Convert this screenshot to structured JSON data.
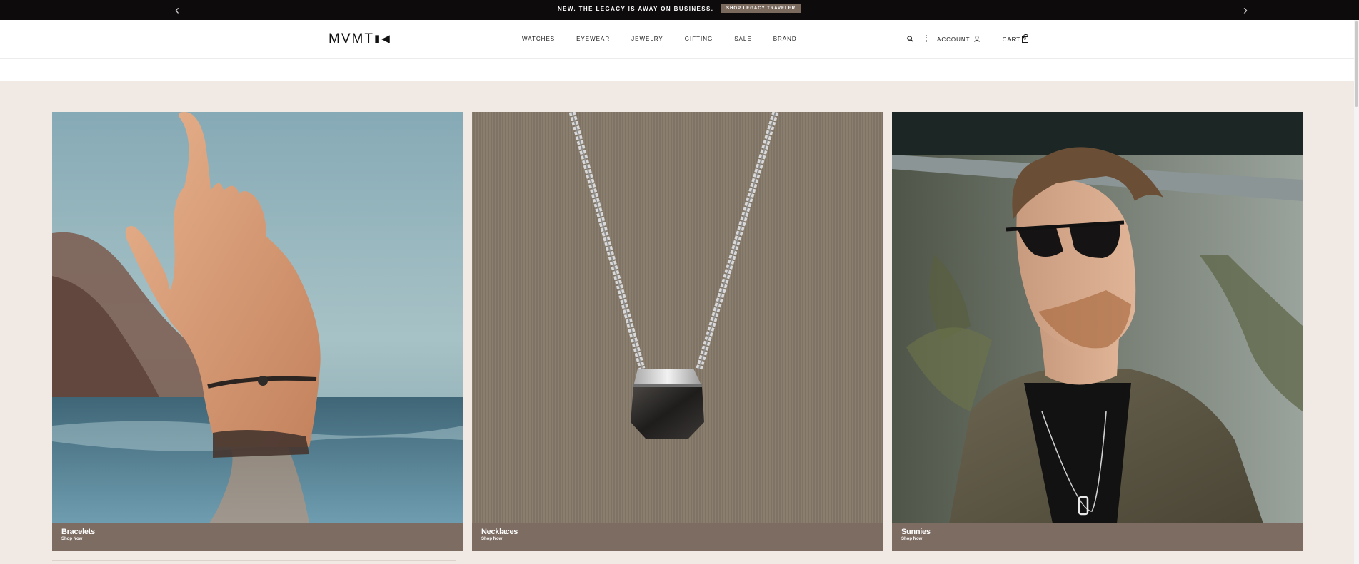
{
  "announcement": {
    "message": "NEW. THE LEGACY IS AWAY ON BUSINESS.",
    "cta": "SHOP LEGACY TRAVELER",
    "prev_icon": "chevron-left-icon",
    "next_icon": "chevron-right-icon"
  },
  "header": {
    "logo": "MVMT",
    "nav": [
      "WATCHES",
      "EYEWEAR",
      "JEWELRY",
      "GIFTING",
      "SALE",
      "BRAND"
    ],
    "account_label": "ACCOUNT",
    "cart_label": "CART",
    "cart_count": "0",
    "search_icon": "search-icon",
    "user_icon": "user-icon",
    "bag_icon": "shopping-bag-icon"
  },
  "categories": [
    {
      "title": "Bracelets",
      "cta": "Shop Now"
    },
    {
      "title": "Necklaces",
      "cta": "Shop Now"
    },
    {
      "title": "Sunnies",
      "cta": "Shop Now"
    }
  ],
  "colors": {
    "announce_bg": "#0d0b0b",
    "cta_bg": "#7a6a5e",
    "page_bg": "#f1e9e4",
    "caption_bg": "#7d6c62"
  }
}
